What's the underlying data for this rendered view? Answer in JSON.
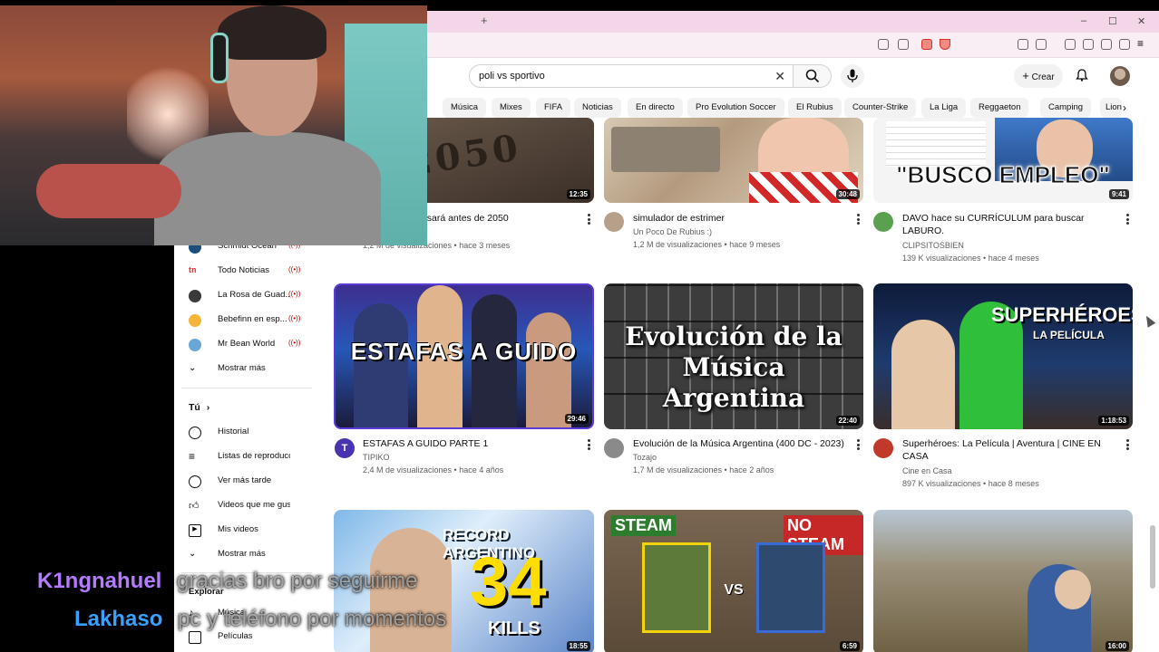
{
  "browser": {
    "new_tab": "+",
    "window_controls": [
      "–",
      "☐",
      "✕"
    ]
  },
  "youtube": {
    "search_value": "poli vs sportivo",
    "create_label": "Crear",
    "chips": [
      "Música",
      "Mixes",
      "FIFA",
      "Noticias",
      "En directo",
      "Pro Evolution Soccer",
      "El Rubius",
      "Counter-Strike",
      "La Liga",
      "Reggaeton",
      "Camping",
      "Lionel"
    ]
  },
  "sidebar": {
    "subscriptions": [
      {
        "label": "Schmidt Ocean",
        "live": "((•))"
      },
      {
        "label": "Todo Noticias",
        "live": "((•))"
      },
      {
        "label": "La Rosa de Guad...",
        "live": "((•))"
      },
      {
        "label": "Bebefinn en esp...",
        "live": "((•))"
      },
      {
        "label": "Mr Bean World",
        "live": "((•))"
      }
    ],
    "show_more_1": "Mostrar más",
    "you_heading": "Tú",
    "you_items": [
      "Historial",
      "Listas de reproducc...",
      "Ver más tarde",
      "Videos que me gus...",
      "Mis videos"
    ],
    "show_more_2": "Mostrar más",
    "explore_heading": "Explorar",
    "explore_items": [
      "Música",
      "Películas"
    ]
  },
  "videos": [
    {
      "title": "...sará antes de 2050",
      "channel": "",
      "meta": "1,2 M de visualizaciones • hace 3 meses",
      "duration": "12:35",
      "thumb_text": "2050"
    },
    {
      "title": "simulador de estrimer",
      "channel": "Un Poco De Rubius :)",
      "meta": "1,2 M de visualizaciones • hace 9 meses",
      "duration": "30:48",
      "thumb_text": ""
    },
    {
      "title": "DAVO hace su CURRÍCULUM para buscar LABURO.",
      "channel": "CLIPSITOSBIEN",
      "meta": "139 K visualizaciones • hace 4 meses",
      "duration": "9:41",
      "thumb_text": "\"BUSCO EMPLEO\""
    },
    {
      "title": "ESTAFAS A GUIDO PARTE 1",
      "channel": "TIPIKO",
      "meta": "2,4 M de visualizaciones • hace 4 años",
      "duration": "29:46",
      "thumb_text": "ESTAFAS A GUIDO"
    },
    {
      "title": "Evolución de la Música Argentina (400 DC - 2023)",
      "channel": "Tozajo",
      "meta": "1,7 M de visualizaciones • hace 2 años",
      "duration": "22:40",
      "thumb_text": "Evolución de la Música Argentina"
    },
    {
      "title": "Superhéroes: La Película | Aventura | CINE EN CASA",
      "channel": "Cine en Casa",
      "meta": "897 K visualizaciones • hace 8 meses",
      "duration": "1:18:53",
      "thumb_text": "SUPERHÉROES",
      "thumb_sub": "LA PELÍCULA"
    },
    {
      "duration": "18:55",
      "thumb_text": "RECORD ARGENTINO",
      "thumb_big": "34",
      "thumb_sub": "KILLS"
    },
    {
      "duration": "6:59",
      "thumb_text": "STEAM",
      "thumb_text2": "NO STEAM",
      "thumb_vs": "VS"
    },
    {
      "duration": "16:00"
    }
  ],
  "chat": [
    {
      "user": "K1ngnahuel",
      "message": "gracias bro por seguirme",
      "color": "#b57bff"
    },
    {
      "user": "Lakhaso",
      "message": "pc y teléfono por momentos",
      "color": "#3aa0ff"
    }
  ]
}
